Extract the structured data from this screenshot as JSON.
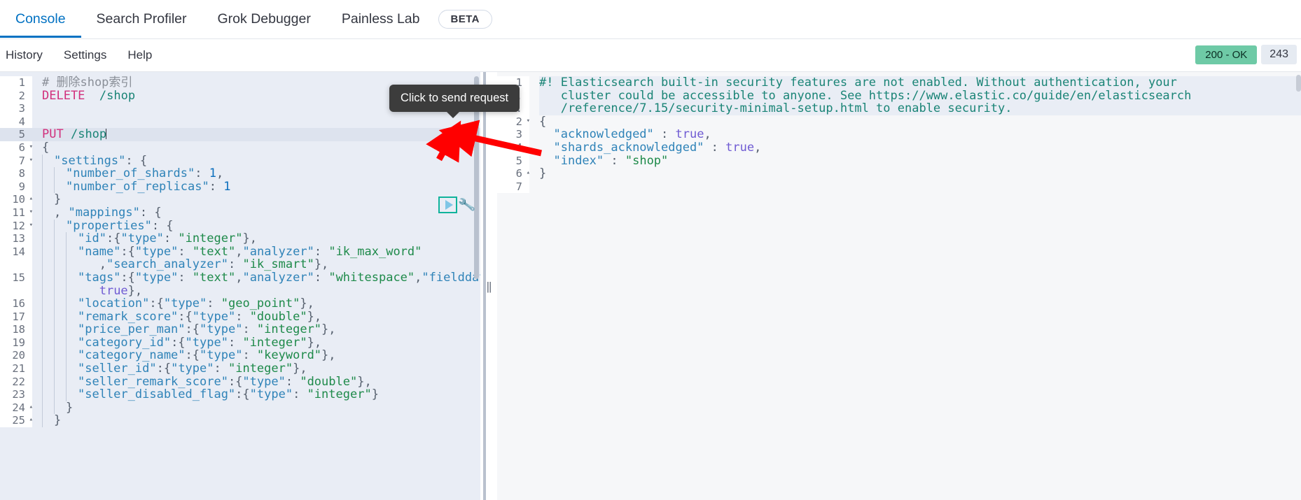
{
  "tabs": [
    {
      "label": "Console",
      "active": true
    },
    {
      "label": "Search Profiler",
      "active": false
    },
    {
      "label": "Grok Debugger",
      "active": false
    },
    {
      "label": "Painless Lab",
      "active": false
    }
  ],
  "beta_badge": "BETA",
  "subbar": {
    "history": "History",
    "settings": "Settings",
    "help": "Help"
  },
  "status": {
    "code": "200 - OK",
    "bytes": "243"
  },
  "tooltip": {
    "text": "Click to send request"
  },
  "icons": {
    "play": "play-icon",
    "wrench": "wrench-icon",
    "splitter": "||"
  },
  "editor": {
    "lines": [
      {
        "num": "1",
        "fold": "",
        "current": false,
        "indent": 0,
        "tokens": [
          {
            "t": "comment",
            "v": "# 删除shop索引"
          }
        ]
      },
      {
        "num": "2",
        "fold": "",
        "current": false,
        "indent": 0,
        "tokens": [
          {
            "t": "method",
            "v": "DELETE"
          },
          {
            "t": "plain",
            "v": "  "
          },
          {
            "t": "url",
            "v": "/shop"
          }
        ]
      },
      {
        "num": "3",
        "fold": "",
        "current": false,
        "indent": 0,
        "tokens": []
      },
      {
        "num": "4",
        "fold": "",
        "current": false,
        "indent": 0,
        "tokens": []
      },
      {
        "num": "5",
        "fold": "",
        "current": true,
        "indent": 0,
        "tokens": [
          {
            "t": "method",
            "v": "PUT"
          },
          {
            "t": "plain",
            "v": " "
          },
          {
            "t": "url",
            "v": "/shop"
          },
          {
            "t": "caret",
            "v": ""
          }
        ]
      },
      {
        "num": "6",
        "fold": "▾",
        "current": false,
        "indent": 0,
        "tokens": [
          {
            "t": "punct",
            "v": "{"
          }
        ]
      },
      {
        "num": "7",
        "fold": "▾",
        "current": false,
        "indent": 1,
        "tokens": [
          {
            "t": "key",
            "v": "\"settings\""
          },
          {
            "t": "punct",
            "v": ": {"
          }
        ]
      },
      {
        "num": "8",
        "fold": "",
        "current": false,
        "indent": 2,
        "tokens": [
          {
            "t": "key",
            "v": "\"number_of_shards\""
          },
          {
            "t": "punct",
            "v": ": "
          },
          {
            "t": "num",
            "v": "1"
          },
          {
            "t": "punct",
            "v": ","
          }
        ]
      },
      {
        "num": "9",
        "fold": "",
        "current": false,
        "indent": 2,
        "tokens": [
          {
            "t": "key",
            "v": "\"number_of_replicas\""
          },
          {
            "t": "punct",
            "v": ": "
          },
          {
            "t": "num",
            "v": "1"
          }
        ]
      },
      {
        "num": "10",
        "fold": "▴",
        "current": false,
        "indent": 1,
        "tokens": [
          {
            "t": "punct",
            "v": "}"
          }
        ]
      },
      {
        "num": "11",
        "fold": "▾",
        "current": false,
        "indent": 1,
        "tokens": [
          {
            "t": "punct",
            "v": ", "
          },
          {
            "t": "key",
            "v": "\"mappings\""
          },
          {
            "t": "punct",
            "v": ": {"
          }
        ]
      },
      {
        "num": "12",
        "fold": "▾",
        "current": false,
        "indent": 2,
        "tokens": [
          {
            "t": "key",
            "v": "\"properties\""
          },
          {
            "t": "punct",
            "v": ": {"
          }
        ]
      },
      {
        "num": "13",
        "fold": "",
        "current": false,
        "indent": 3,
        "tokens": [
          {
            "t": "key",
            "v": "\"id\""
          },
          {
            "t": "punct",
            "v": ":{"
          },
          {
            "t": "key",
            "v": "\"type\""
          },
          {
            "t": "punct",
            "v": ": "
          },
          {
            "t": "str",
            "v": "\"integer\""
          },
          {
            "t": "punct",
            "v": "},"
          }
        ]
      },
      {
        "num": "14",
        "fold": "",
        "current": false,
        "indent": 3,
        "tokens": [
          {
            "t": "key",
            "v": "\"name\""
          },
          {
            "t": "punct",
            "v": ":{"
          },
          {
            "t": "key",
            "v": "\"type\""
          },
          {
            "t": "punct",
            "v": ": "
          },
          {
            "t": "str",
            "v": "\"text\""
          },
          {
            "t": "punct",
            "v": ","
          },
          {
            "t": "key",
            "v": "\"analyzer\""
          },
          {
            "t": "punct",
            "v": ": "
          },
          {
            "t": "str",
            "v": "\"ik_max_word\""
          }
        ]
      },
      {
        "num": "",
        "fold": "",
        "current": false,
        "indent": 3,
        "wrap": true,
        "tokens": [
          {
            "t": "punct",
            "v": " ,"
          },
          {
            "t": "key",
            "v": "\"search_analyzer\""
          },
          {
            "t": "punct",
            "v": ": "
          },
          {
            "t": "str",
            "v": "\"ik_smart\""
          },
          {
            "t": "punct",
            "v": "},"
          }
        ]
      },
      {
        "num": "15",
        "fold": "",
        "current": false,
        "indent": 3,
        "tokens": [
          {
            "t": "key",
            "v": "\"tags\""
          },
          {
            "t": "punct",
            "v": ":{"
          },
          {
            "t": "key",
            "v": "\"type\""
          },
          {
            "t": "punct",
            "v": ": "
          },
          {
            "t": "str",
            "v": "\"text\""
          },
          {
            "t": "punct",
            "v": ","
          },
          {
            "t": "key",
            "v": "\"analyzer\""
          },
          {
            "t": "punct",
            "v": ": "
          },
          {
            "t": "str",
            "v": "\"whitespace\""
          },
          {
            "t": "punct",
            "v": ","
          },
          {
            "t": "key",
            "v": "\"fielddata\""
          },
          {
            "t": "punct",
            "v": ":"
          }
        ]
      },
      {
        "num": "",
        "fold": "",
        "current": false,
        "indent": 3,
        "wrap": true,
        "tokens": [
          {
            "t": "bool",
            "v": " true"
          },
          {
            "t": "punct",
            "v": "},"
          }
        ]
      },
      {
        "num": "16",
        "fold": "",
        "current": false,
        "indent": 3,
        "tokens": [
          {
            "t": "key",
            "v": "\"location\""
          },
          {
            "t": "punct",
            "v": ":{"
          },
          {
            "t": "key",
            "v": "\"type\""
          },
          {
            "t": "punct",
            "v": ": "
          },
          {
            "t": "str",
            "v": "\"geo_point\""
          },
          {
            "t": "punct",
            "v": "},"
          }
        ]
      },
      {
        "num": "17",
        "fold": "",
        "current": false,
        "indent": 3,
        "tokens": [
          {
            "t": "key",
            "v": "\"remark_score\""
          },
          {
            "t": "punct",
            "v": ":{"
          },
          {
            "t": "key",
            "v": "\"type\""
          },
          {
            "t": "punct",
            "v": ": "
          },
          {
            "t": "str",
            "v": "\"double\""
          },
          {
            "t": "punct",
            "v": "},"
          }
        ]
      },
      {
        "num": "18",
        "fold": "",
        "current": false,
        "indent": 3,
        "tokens": [
          {
            "t": "key",
            "v": "\"price_per_man\""
          },
          {
            "t": "punct",
            "v": ":{"
          },
          {
            "t": "key",
            "v": "\"type\""
          },
          {
            "t": "punct",
            "v": ": "
          },
          {
            "t": "str",
            "v": "\"integer\""
          },
          {
            "t": "punct",
            "v": "},"
          }
        ]
      },
      {
        "num": "19",
        "fold": "",
        "current": false,
        "indent": 3,
        "tokens": [
          {
            "t": "key",
            "v": "\"category_id\""
          },
          {
            "t": "punct",
            "v": ":{"
          },
          {
            "t": "key",
            "v": "\"type\""
          },
          {
            "t": "punct",
            "v": ": "
          },
          {
            "t": "str",
            "v": "\"integer\""
          },
          {
            "t": "punct",
            "v": "},"
          }
        ]
      },
      {
        "num": "20",
        "fold": "",
        "current": false,
        "indent": 3,
        "tokens": [
          {
            "t": "key",
            "v": "\"category_name\""
          },
          {
            "t": "punct",
            "v": ":{"
          },
          {
            "t": "key",
            "v": "\"type\""
          },
          {
            "t": "punct",
            "v": ": "
          },
          {
            "t": "str",
            "v": "\"keyword\""
          },
          {
            "t": "punct",
            "v": "},"
          }
        ]
      },
      {
        "num": "21",
        "fold": "",
        "current": false,
        "indent": 3,
        "tokens": [
          {
            "t": "key",
            "v": "\"seller_id\""
          },
          {
            "t": "punct",
            "v": ":{"
          },
          {
            "t": "key",
            "v": "\"type\""
          },
          {
            "t": "punct",
            "v": ": "
          },
          {
            "t": "str",
            "v": "\"integer\""
          },
          {
            "t": "punct",
            "v": "},"
          }
        ]
      },
      {
        "num": "22",
        "fold": "",
        "current": false,
        "indent": 3,
        "tokens": [
          {
            "t": "key",
            "v": "\"seller_remark_score\""
          },
          {
            "t": "punct",
            "v": ":{"
          },
          {
            "t": "key",
            "v": "\"type\""
          },
          {
            "t": "punct",
            "v": ": "
          },
          {
            "t": "str",
            "v": "\"double\""
          },
          {
            "t": "punct",
            "v": "},"
          }
        ]
      },
      {
        "num": "23",
        "fold": "",
        "current": false,
        "indent": 3,
        "tokens": [
          {
            "t": "key",
            "v": "\"seller_disabled_flag\""
          },
          {
            "t": "punct",
            "v": ":{"
          },
          {
            "t": "key",
            "v": "\"type\""
          },
          {
            "t": "punct",
            "v": ": "
          },
          {
            "t": "str",
            "v": "\"integer\""
          },
          {
            "t": "punct",
            "v": "}"
          }
        ]
      },
      {
        "num": "24",
        "fold": "▴",
        "current": false,
        "indent": 2,
        "tokens": [
          {
            "t": "punct",
            "v": "}"
          }
        ]
      },
      {
        "num": "25",
        "fold": "▴",
        "current": false,
        "indent": 1,
        "tokens": [
          {
            "t": "punct",
            "v": "}"
          }
        ]
      }
    ]
  },
  "response": {
    "lines": [
      {
        "num": "1",
        "fold": "",
        "warn": true,
        "tokens": [
          {
            "t": "warn",
            "v": "#! Elasticsearch built-in security features are not enabled. Without authentication, your"
          }
        ]
      },
      {
        "num": "",
        "fold": "",
        "warn": true,
        "tokens": [
          {
            "t": "warn",
            "v": "   cluster could be accessible to anyone. See https://www.elastic.co/guide/en/elasticsearch"
          }
        ]
      },
      {
        "num": "",
        "fold": "",
        "warn": true,
        "tokens": [
          {
            "t": "warn",
            "v": "   /reference/7.15/security-minimal-setup.html to enable security."
          }
        ]
      },
      {
        "num": "2",
        "fold": "▾",
        "warn": false,
        "tokens": [
          {
            "t": "punct",
            "v": "{"
          }
        ]
      },
      {
        "num": "3",
        "fold": "",
        "warn": false,
        "tokens": [
          {
            "t": "plain",
            "v": "  "
          },
          {
            "t": "key",
            "v": "\"acknowledged\""
          },
          {
            "t": "punct",
            "v": " : "
          },
          {
            "t": "bool",
            "v": "true"
          },
          {
            "t": "punct",
            "v": ","
          }
        ]
      },
      {
        "num": "4",
        "fold": "",
        "warn": false,
        "tokens": [
          {
            "t": "plain",
            "v": "  "
          },
          {
            "t": "key",
            "v": "\"shards_acknowledged\""
          },
          {
            "t": "punct",
            "v": " : "
          },
          {
            "t": "bool",
            "v": "true"
          },
          {
            "t": "punct",
            "v": ","
          }
        ]
      },
      {
        "num": "5",
        "fold": "",
        "warn": false,
        "tokens": [
          {
            "t": "plain",
            "v": "  "
          },
          {
            "t": "key",
            "v": "\"index\""
          },
          {
            "t": "punct",
            "v": " : "
          },
          {
            "t": "str",
            "v": "\"shop\""
          }
        ]
      },
      {
        "num": "6",
        "fold": "▴",
        "warn": false,
        "tokens": [
          {
            "t": "punct",
            "v": "}"
          }
        ]
      },
      {
        "num": "7",
        "fold": "",
        "warn": false,
        "tokens": []
      }
    ]
  },
  "colors": {
    "accent": "#0071c2",
    "status_ok_bg": "#6ecaa6",
    "tooltip_bg": "#3c3c3c",
    "arrow": "#ff0000",
    "play_border": "#0fb39b"
  }
}
